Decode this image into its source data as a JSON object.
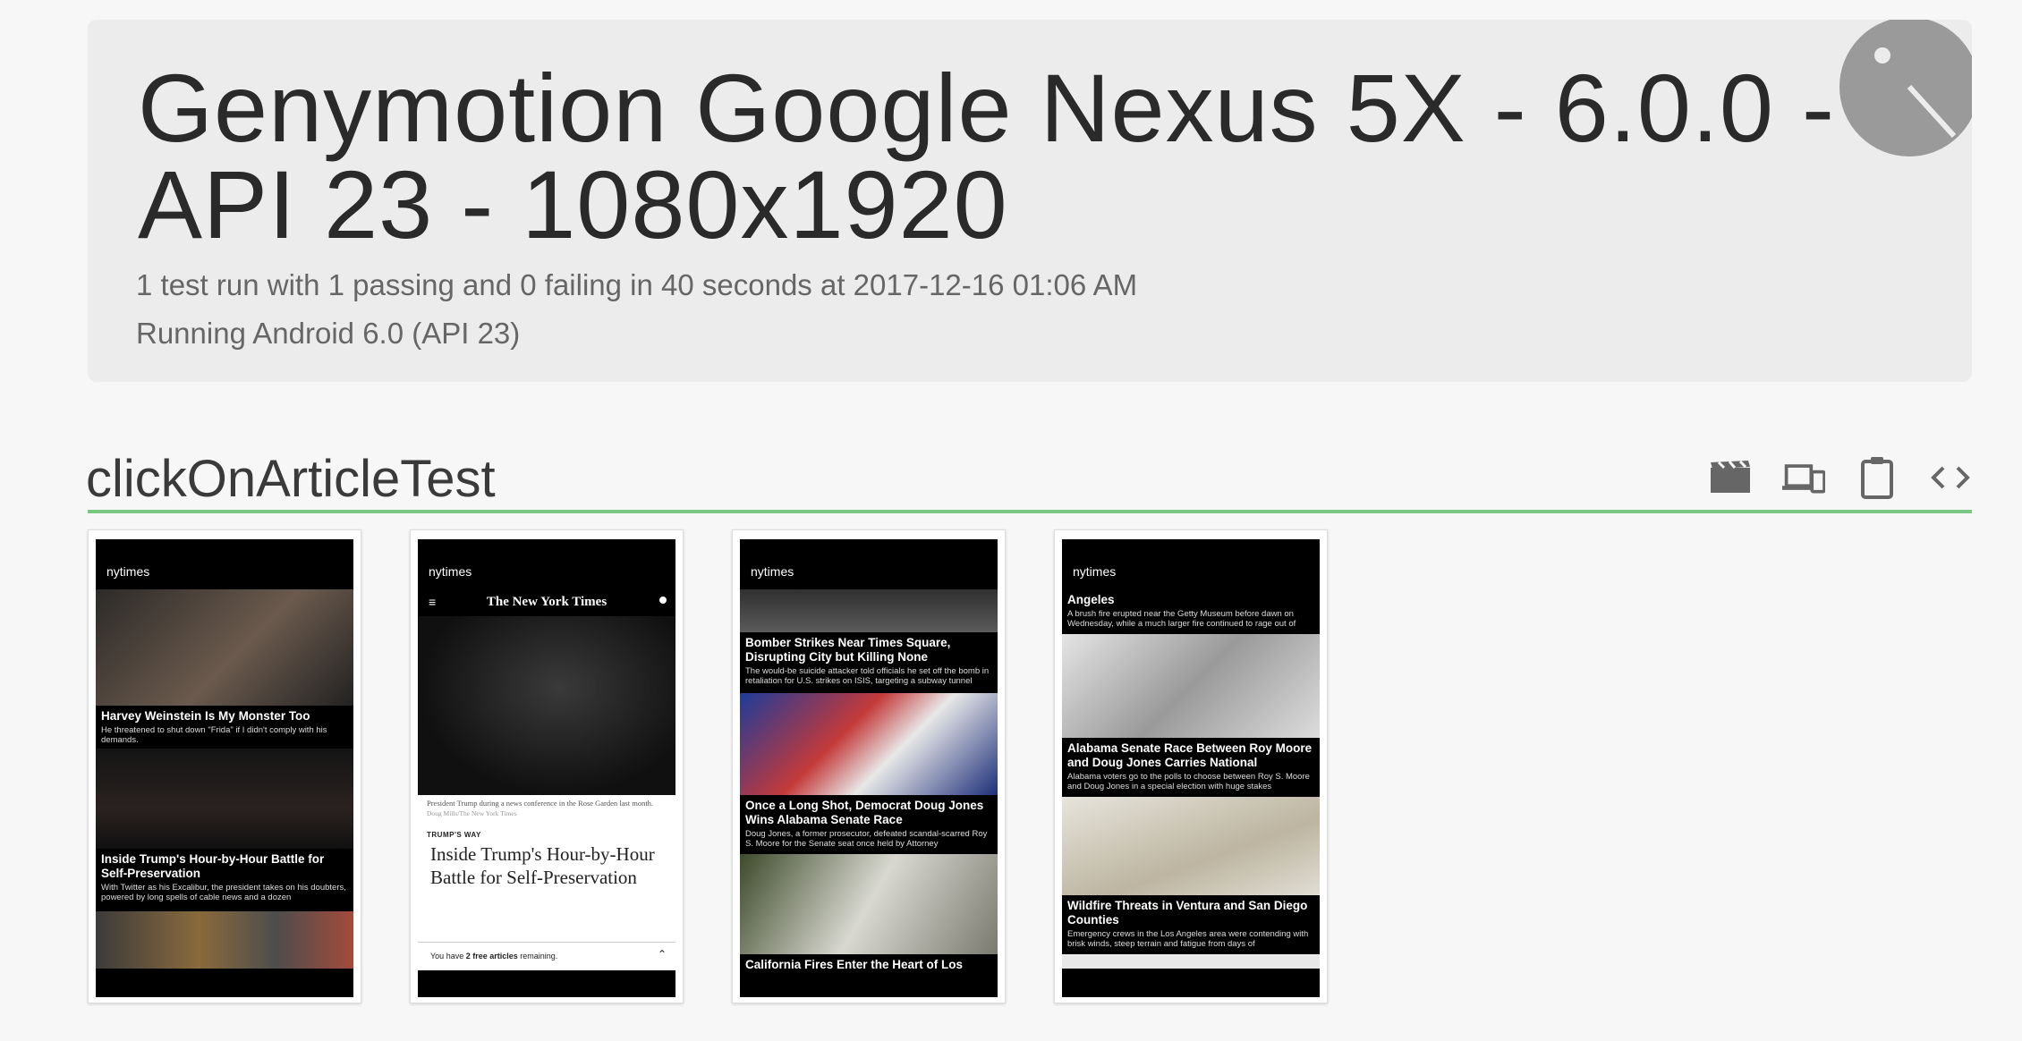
{
  "header": {
    "device_title": "Genymotion Google Nexus 5X - 6.0.0 - API 23 - 1080x1920",
    "summary": "1 test run with 1 passing and 0 failing in 40 seconds at 2017-12-16 01:06 AM",
    "os": "Running Android 6.0 (API 23)"
  },
  "test": {
    "name": "clickOnArticleTest",
    "toolbar": [
      {
        "icon": "video-icon"
      },
      {
        "icon": "devices-icon"
      },
      {
        "icon": "clipboard-icon"
      },
      {
        "icon": "code-icon"
      }
    ]
  },
  "screenshots": [
    {
      "app_title": "nytimes",
      "stories": [
        {
          "headline": "Harvey Weinstein Is My Monster Too",
          "summary": "He threatened to shut down \"Frida\" if I didn't comply with his demands."
        },
        {
          "headline": "Inside Trump's Hour-by-Hour Battle for Self-Preservation",
          "summary": "With Twitter as his Excalibur, the president takes on his doubters, powered by long spells of cable news and a dozen"
        }
      ]
    },
    {
      "app_title": "nytimes",
      "masthead": "The New York Times",
      "caption": "President Trump during a news conference in the Rose Garden last month.",
      "credit": "Doug Mills/The New York Times",
      "kicker": "TRUMP'S WAY",
      "headline": "Inside Trump's Hour-by-Hour Battle for Self-Preservation",
      "paywall_pre": "You have ",
      "paywall_bold": "2 free articles",
      "paywall_post": " remaining."
    },
    {
      "app_title": "nytimes",
      "stories": [
        {
          "headline": "Bomber Strikes Near Times Square, Disrupting City but Killing None",
          "summary": "The would-be suicide attacker told officials he set off the bomb in retaliation for U.S. strikes on ISIS, targeting a subway tunnel"
        },
        {
          "headline": "Once a Long Shot, Democrat Doug Jones Wins Alabama Senate Race",
          "summary": "Doug Jones, a former prosecutor, defeated scandal-scarred Roy S. Moore for the Senate seat once held by Attorney"
        },
        {
          "headline": "California Fires Enter the Heart of Los",
          "summary": ""
        }
      ]
    },
    {
      "app_title": "nytimes",
      "stories": [
        {
          "headline": "Angeles",
          "summary": "A brush fire erupted near the Getty Museum before dawn on Wednesday, while a much larger fire continued to rage out of"
        },
        {
          "headline": "Alabama Senate Race Between Roy Moore and Doug Jones Carries National",
          "summary": "Alabama voters go to the polls to choose between Roy S. Moore and Doug Jones in a special election with huge stakes"
        },
        {
          "headline": "Wildfire Threats in Ventura and San Diego Counties",
          "summary": "Emergency crews in the Los Angeles area were contending with brisk winds, steep terrain and fatigue from days of"
        }
      ]
    }
  ]
}
